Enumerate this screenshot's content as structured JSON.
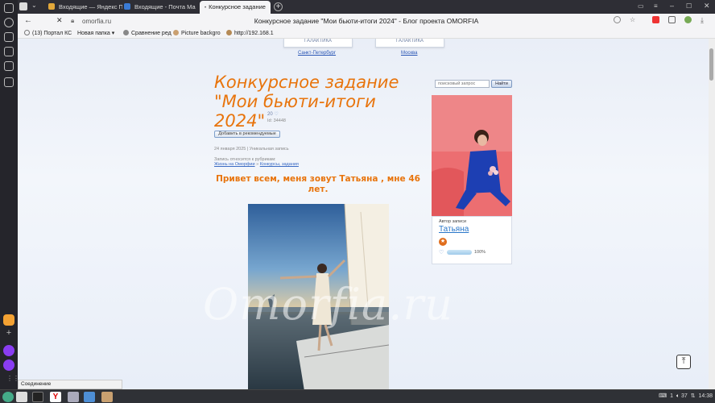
{
  "tabs": [
    {
      "label": "Входящие — Яндекс П",
      "color": "#e2a83a"
    },
    {
      "label": "Входящие - Почта Ма",
      "color": "#3a7bd5"
    },
    {
      "label": "Конкурсное задание",
      "color": "#7b61ff",
      "active": true
    }
  ],
  "address": {
    "url": "omorfia.ru",
    "page_title": "Конкурсное задание \"Мои бьюти-итоги 2024\" - Блог проекта OMORFIA"
  },
  "bookmarks": [
    {
      "label": "(13) Портал КС",
      "color": "#d0d0d0"
    },
    {
      "label": "Новая папка",
      "color": "",
      "chevron": "▾"
    },
    {
      "label": "Сравнение ред",
      "color": "#888"
    },
    {
      "label": "Picture backgro",
      "color": "#caa070"
    },
    {
      "label": "http://192.168.1",
      "color": "#b58a55"
    }
  ],
  "top_partners": [
    {
      "brand": "ГАЛАКТИКА",
      "city": "Санкт-Петербург"
    },
    {
      "brand": "ГАЛАКТИКА",
      "city": "Москва"
    }
  ],
  "post": {
    "title": "Конкурсное задание \"Мои бьюти-итоги 2024\"",
    "likes": "20",
    "id_text": "Id: 34448",
    "recommend_btn": "Добавить в рекомендуемые",
    "date_line": "24 января 2025 | Уникальная запись",
    "rubric_label": "Запись относится к рубрикам:",
    "rubric_1": "Жизнь на Оморфии",
    "rubric_sep": "»",
    "rubric_2": "Конкурсы, задания",
    "greeting": "Привет всем, меня зовут Татьяна , мне 46 лет."
  },
  "search": {
    "placeholder": "поисковый запрос",
    "button": "Найти"
  },
  "author": {
    "label": "Автор записи",
    "name": "Татьяна",
    "badge": "★",
    "progress": "100%"
  },
  "watermark": "Omorfia.ru",
  "status_text": "Соединение",
  "tray": {
    "lang": "1",
    "volume": "37",
    "time": "14:38"
  },
  "colors": {
    "accent_orange": "#e8740c",
    "link_blue": "#2a77c9"
  }
}
